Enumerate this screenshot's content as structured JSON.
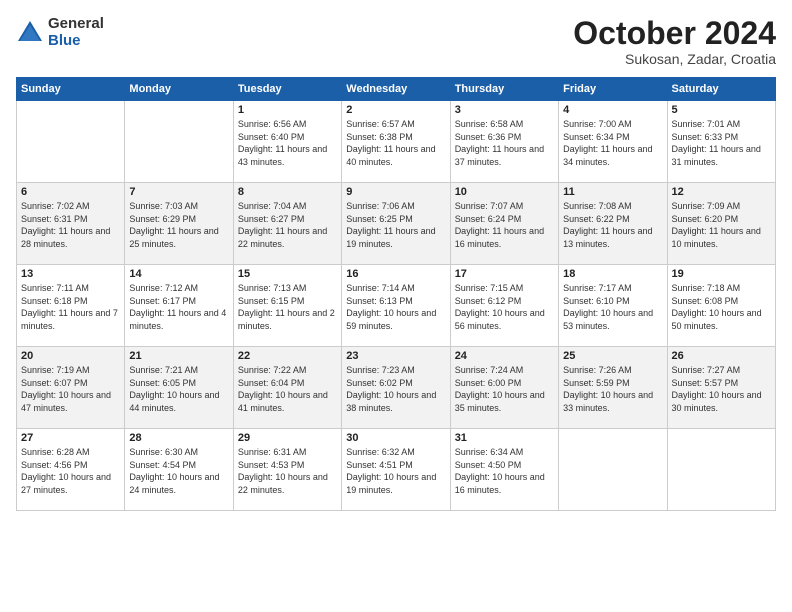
{
  "logo": {
    "general": "General",
    "blue": "Blue"
  },
  "title": "October 2024",
  "subtitle": "Sukosan, Zadar, Croatia",
  "headers": [
    "Sunday",
    "Monday",
    "Tuesday",
    "Wednesday",
    "Thursday",
    "Friday",
    "Saturday"
  ],
  "weeks": [
    [
      {
        "day": "",
        "content": ""
      },
      {
        "day": "",
        "content": ""
      },
      {
        "day": "1",
        "content": "Sunrise: 6:56 AM\nSunset: 6:40 PM\nDaylight: 11 hours and 43 minutes."
      },
      {
        "day": "2",
        "content": "Sunrise: 6:57 AM\nSunset: 6:38 PM\nDaylight: 11 hours and 40 minutes."
      },
      {
        "day": "3",
        "content": "Sunrise: 6:58 AM\nSunset: 6:36 PM\nDaylight: 11 hours and 37 minutes."
      },
      {
        "day": "4",
        "content": "Sunrise: 7:00 AM\nSunset: 6:34 PM\nDaylight: 11 hours and 34 minutes."
      },
      {
        "day": "5",
        "content": "Sunrise: 7:01 AM\nSunset: 6:33 PM\nDaylight: 11 hours and 31 minutes."
      }
    ],
    [
      {
        "day": "6",
        "content": "Sunrise: 7:02 AM\nSunset: 6:31 PM\nDaylight: 11 hours and 28 minutes."
      },
      {
        "day": "7",
        "content": "Sunrise: 7:03 AM\nSunset: 6:29 PM\nDaylight: 11 hours and 25 minutes."
      },
      {
        "day": "8",
        "content": "Sunrise: 7:04 AM\nSunset: 6:27 PM\nDaylight: 11 hours and 22 minutes."
      },
      {
        "day": "9",
        "content": "Sunrise: 7:06 AM\nSunset: 6:25 PM\nDaylight: 11 hours and 19 minutes."
      },
      {
        "day": "10",
        "content": "Sunrise: 7:07 AM\nSunset: 6:24 PM\nDaylight: 11 hours and 16 minutes."
      },
      {
        "day": "11",
        "content": "Sunrise: 7:08 AM\nSunset: 6:22 PM\nDaylight: 11 hours and 13 minutes."
      },
      {
        "day": "12",
        "content": "Sunrise: 7:09 AM\nSunset: 6:20 PM\nDaylight: 11 hours and 10 minutes."
      }
    ],
    [
      {
        "day": "13",
        "content": "Sunrise: 7:11 AM\nSunset: 6:18 PM\nDaylight: 11 hours and 7 minutes."
      },
      {
        "day": "14",
        "content": "Sunrise: 7:12 AM\nSunset: 6:17 PM\nDaylight: 11 hours and 4 minutes."
      },
      {
        "day": "15",
        "content": "Sunrise: 7:13 AM\nSunset: 6:15 PM\nDaylight: 11 hours and 2 minutes."
      },
      {
        "day": "16",
        "content": "Sunrise: 7:14 AM\nSunset: 6:13 PM\nDaylight: 10 hours and 59 minutes."
      },
      {
        "day": "17",
        "content": "Sunrise: 7:15 AM\nSunset: 6:12 PM\nDaylight: 10 hours and 56 minutes."
      },
      {
        "day": "18",
        "content": "Sunrise: 7:17 AM\nSunset: 6:10 PM\nDaylight: 10 hours and 53 minutes."
      },
      {
        "day": "19",
        "content": "Sunrise: 7:18 AM\nSunset: 6:08 PM\nDaylight: 10 hours and 50 minutes."
      }
    ],
    [
      {
        "day": "20",
        "content": "Sunrise: 7:19 AM\nSunset: 6:07 PM\nDaylight: 10 hours and 47 minutes."
      },
      {
        "day": "21",
        "content": "Sunrise: 7:21 AM\nSunset: 6:05 PM\nDaylight: 10 hours and 44 minutes."
      },
      {
        "day": "22",
        "content": "Sunrise: 7:22 AM\nSunset: 6:04 PM\nDaylight: 10 hours and 41 minutes."
      },
      {
        "day": "23",
        "content": "Sunrise: 7:23 AM\nSunset: 6:02 PM\nDaylight: 10 hours and 38 minutes."
      },
      {
        "day": "24",
        "content": "Sunrise: 7:24 AM\nSunset: 6:00 PM\nDaylight: 10 hours and 35 minutes."
      },
      {
        "day": "25",
        "content": "Sunrise: 7:26 AM\nSunset: 5:59 PM\nDaylight: 10 hours and 33 minutes."
      },
      {
        "day": "26",
        "content": "Sunrise: 7:27 AM\nSunset: 5:57 PM\nDaylight: 10 hours and 30 minutes."
      }
    ],
    [
      {
        "day": "27",
        "content": "Sunrise: 6:28 AM\nSunset: 4:56 PM\nDaylight: 10 hours and 27 minutes."
      },
      {
        "day": "28",
        "content": "Sunrise: 6:30 AM\nSunset: 4:54 PM\nDaylight: 10 hours and 24 minutes."
      },
      {
        "day": "29",
        "content": "Sunrise: 6:31 AM\nSunset: 4:53 PM\nDaylight: 10 hours and 22 minutes."
      },
      {
        "day": "30",
        "content": "Sunrise: 6:32 AM\nSunset: 4:51 PM\nDaylight: 10 hours and 19 minutes."
      },
      {
        "day": "31",
        "content": "Sunrise: 6:34 AM\nSunset: 4:50 PM\nDaylight: 10 hours and 16 minutes."
      },
      {
        "day": "",
        "content": ""
      },
      {
        "day": "",
        "content": ""
      }
    ]
  ]
}
